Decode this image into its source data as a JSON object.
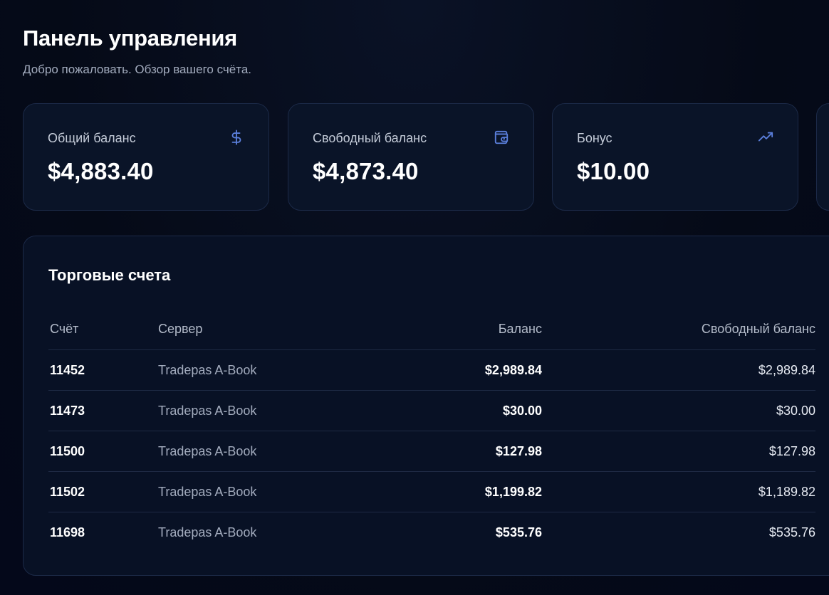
{
  "header": {
    "title": "Панель управления",
    "subtitle": "Добро пожаловать. Обзор вашего счёта."
  },
  "cards": [
    {
      "label": "Общий баланс",
      "value": "$4,883.40",
      "icon": "dollar-icon"
    },
    {
      "label": "Свободный баланс",
      "value": "$4,873.40",
      "icon": "wallet-icon"
    },
    {
      "label": "Бонус",
      "value": "$10.00",
      "icon": "trending-up-icon"
    }
  ],
  "accounts": {
    "title": "Торговые счета",
    "columns": [
      "Счёт",
      "Сервер",
      "Баланс",
      "Свободный баланс"
    ],
    "rows": [
      {
        "account": "11452",
        "server": "Tradepas A-Book",
        "balance": "$2,989.84",
        "free": "$2,989.84"
      },
      {
        "account": "11473",
        "server": "Tradepas A-Book",
        "balance": "$30.00",
        "free": "$30.00"
      },
      {
        "account": "11500",
        "server": "Tradepas A-Book",
        "balance": "$127.98",
        "free": "$127.98"
      },
      {
        "account": "11502",
        "server": "Tradepas A-Book",
        "balance": "$1,199.82",
        "free": "$1,189.82"
      },
      {
        "account": "11698",
        "server": "Tradepas A-Book",
        "balance": "$535.76",
        "free": "$535.76"
      }
    ]
  },
  "colors": {
    "background": "#050a17",
    "card": "#0a1428",
    "border": "#1c2a48",
    "accent_icon": "#5b7fdc"
  }
}
